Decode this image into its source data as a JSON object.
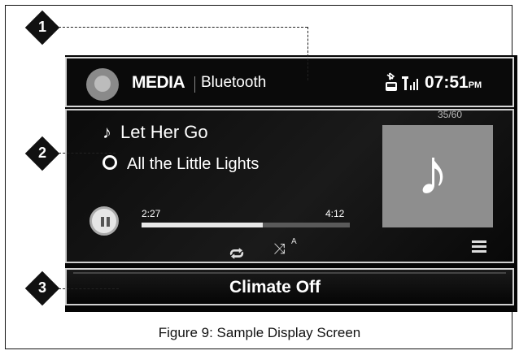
{
  "header": {
    "mode_label": "MEDIA",
    "source_label": "Bluetooth",
    "time": "07:51",
    "ampm": "PM"
  },
  "now_playing": {
    "song_title": "Let Her Go",
    "album_title": "All the Little Lights",
    "track_count": "35/60",
    "elapsed": "2:27",
    "total": "4:12",
    "progress_fraction": 0.583
  },
  "footer": {
    "climate_label": "Climate Off"
  },
  "callouts": [
    "1",
    "2",
    "3"
  ],
  "caption": "Figure 9: Sample Display Screen",
  "icons": {
    "media": "media-disc-icon",
    "bluetooth": "bluetooth-phone-icon",
    "signal": "signal-strength-icon",
    "pause": "pause-icon",
    "repeat": "repeat-icon",
    "shuffle": "shuffle-icon",
    "menu": "list-menu-icon",
    "note": "music-note-icon",
    "disc": "album-disc-icon"
  }
}
